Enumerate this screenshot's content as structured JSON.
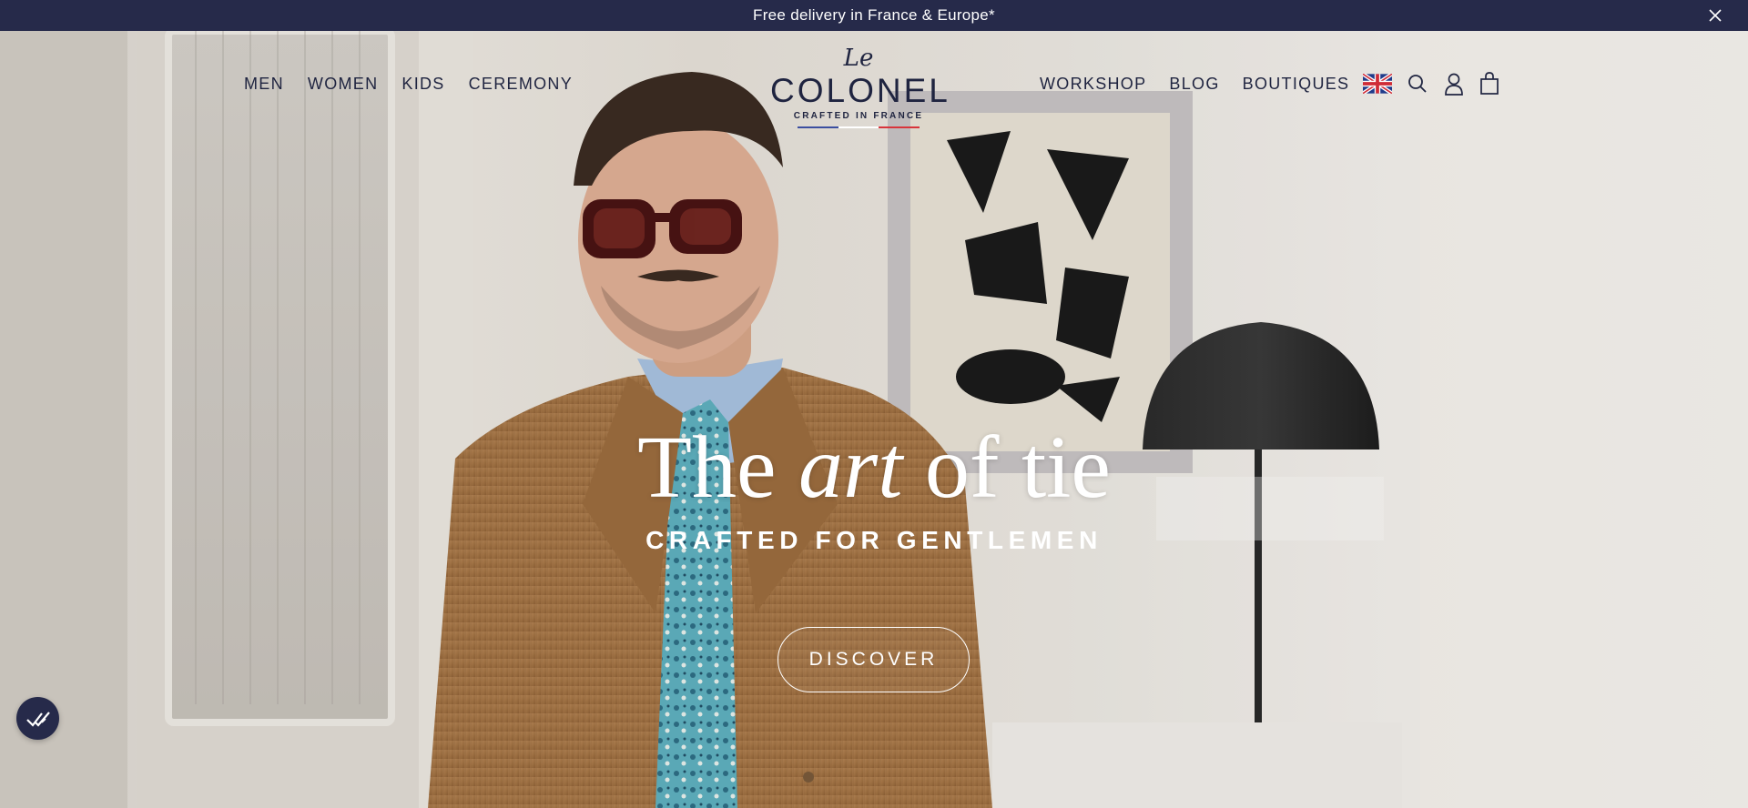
{
  "announcement": {
    "text": "Free delivery in France & Europe*",
    "close_icon": "close-icon"
  },
  "brand": {
    "logo_prefix": "Le",
    "logo_name": "COLONEL",
    "logo_tagline": "CRAFTED IN FRANCE",
    "flag_colors": [
      "#3b4ea0",
      "#ffffff",
      "#d8343b"
    ]
  },
  "nav": {
    "left": [
      {
        "label": "MEN"
      },
      {
        "label": "WOMEN"
      },
      {
        "label": "KIDS"
      },
      {
        "label": "CEREMONY"
      }
    ],
    "right": [
      {
        "label": "WORKSHOP"
      },
      {
        "label": "BLOG"
      },
      {
        "label": "BOUTIQUES"
      }
    ],
    "icons": [
      "uk-flag-icon",
      "search-icon",
      "account-icon",
      "cart-icon"
    ]
  },
  "hero": {
    "title_part1": "The ",
    "title_italic": "art",
    "title_part2": " of tie",
    "subtitle": "CRAFTED FOR GENTLEMEN",
    "cta_label": "DISCOVER"
  },
  "colors": {
    "navy": "#262a4a",
    "text_dark": "#1f2440",
    "white": "#ffffff"
  },
  "cookie_badge": {
    "icon": "double-check-icon"
  }
}
